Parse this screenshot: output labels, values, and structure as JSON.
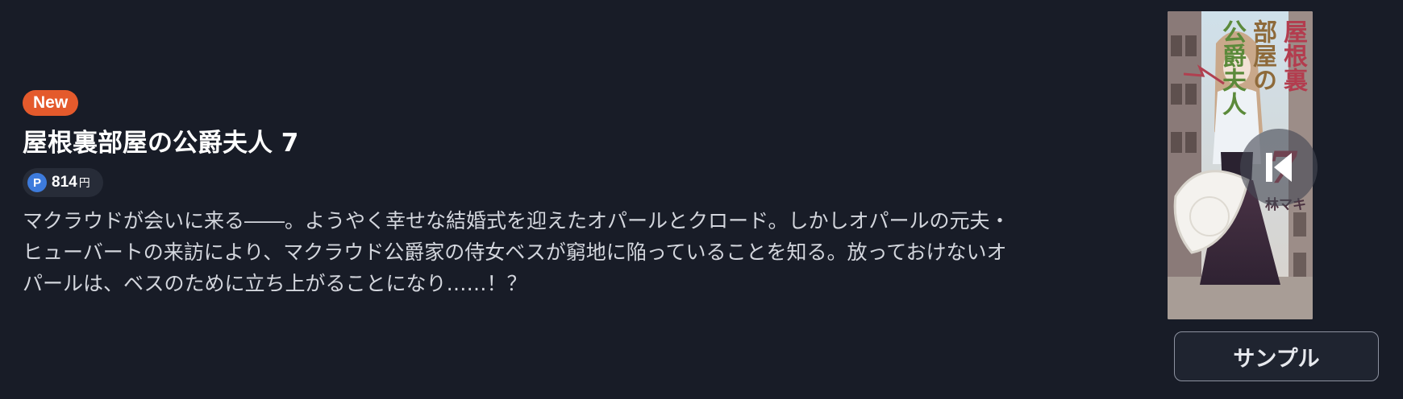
{
  "product": {
    "badge": "New",
    "title": "屋根裏部屋の公爵夫人 7",
    "price": {
      "point_icon": "P",
      "value": "814",
      "unit": "円"
    },
    "description_lines": [
      "マクラウドが会いに来る――。ようやく幸せな結婚式を迎えたオパールとクロード。しかしオパールの元夫・",
      "ヒューバートの来訪により、マクラウド公爵家の侍女ベスが窮地に陥っていることを知る。放っておけないオ",
      "パールは、ベスのために立ち上がることになり……！？"
    ]
  },
  "cover": {
    "title_columns": [
      "屋根裏",
      "部屋の",
      "公爵夫人"
    ],
    "volume": "7",
    "author": "林マキ"
  },
  "actions": {
    "sample_label": "サンプル",
    "play_icon": "play-skip-icon"
  },
  "colors": {
    "background": "#181c27",
    "badge": "#e45a2c",
    "point": "#3d7bdc"
  }
}
